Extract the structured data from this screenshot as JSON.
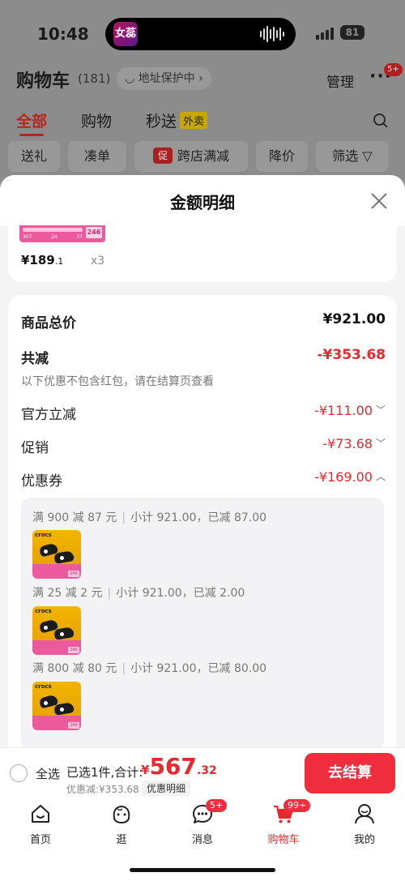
{
  "status_bar": {
    "time": "10:48",
    "app_icon_text": "女蕊",
    "battery": "81"
  },
  "cart_page": {
    "title": "购物车",
    "count": "(181)",
    "address_chip": "地址保护中",
    "manage": "管理",
    "more_badge": "5+",
    "tabs": [
      {
        "label": "全部"
      },
      {
        "label": "购物"
      },
      {
        "label": "秒送",
        "tag": "外卖"
      }
    ],
    "chips": [
      {
        "label": "送礼"
      },
      {
        "label": "凑单"
      },
      {
        "label": "跨店满减",
        "tag": "促"
      },
      {
        "label": "降价"
      },
      {
        "label": "筛选"
      }
    ]
  },
  "sheet": {
    "title": "金额明细",
    "top_item": {
      "thumb_tag": "246",
      "thumb_nums": [
        "307",
        "24",
        "37"
      ],
      "price_int": "¥189",
      "price_dec": ".1",
      "qty": "x3"
    },
    "rows": {
      "goods_total_label": "商品总价",
      "goods_total_value": "¥921.00",
      "total_reduce_label": "共减",
      "total_reduce_value": "-¥353.68",
      "note": "以下优惠不包含红包，请在结算页查看",
      "official_label": "官方立减",
      "official_value": "-¥111.00",
      "promo_label": "促销",
      "promo_value": "-¥73.68",
      "coupon_label": "优惠券",
      "coupon_value": "-¥169.00"
    },
    "coupon_details": [
      {
        "rule": "满 900 减 87 元",
        "summary": "小计 921.00，已减 87.00"
      },
      {
        "rule": "满 25 减 2 元",
        "summary": "小计 921.00，已减 2.00"
      },
      {
        "rule": "满 800 减 80 元",
        "summary": "小计 921.00，已减 80.00"
      }
    ],
    "thumb_brand": "crocs",
    "thumb_tag": "246"
  },
  "checkout": {
    "select_all": "全选",
    "selected_text": "已选1件,合计:",
    "total_currency": "¥",
    "total_int": "567",
    "total_dec": ".32",
    "discount": "优惠减:¥353.68",
    "detail_link": "优惠明细",
    "pay_button": "去结算"
  },
  "tabbar": [
    {
      "label": "首页",
      "icon": "home-icon"
    },
    {
      "label": "逛",
      "icon": "face-icon"
    },
    {
      "label": "消息",
      "icon": "message-icon",
      "badge": "5+"
    },
    {
      "label": "购物车",
      "icon": "cart-icon",
      "badge": "99+",
      "active": true
    },
    {
      "label": "我的",
      "icon": "profile-icon"
    }
  ],
  "colors": {
    "accent": "#e5292e",
    "pay_button": "#ee2d3d",
    "overlay": "#8c8c8c"
  }
}
